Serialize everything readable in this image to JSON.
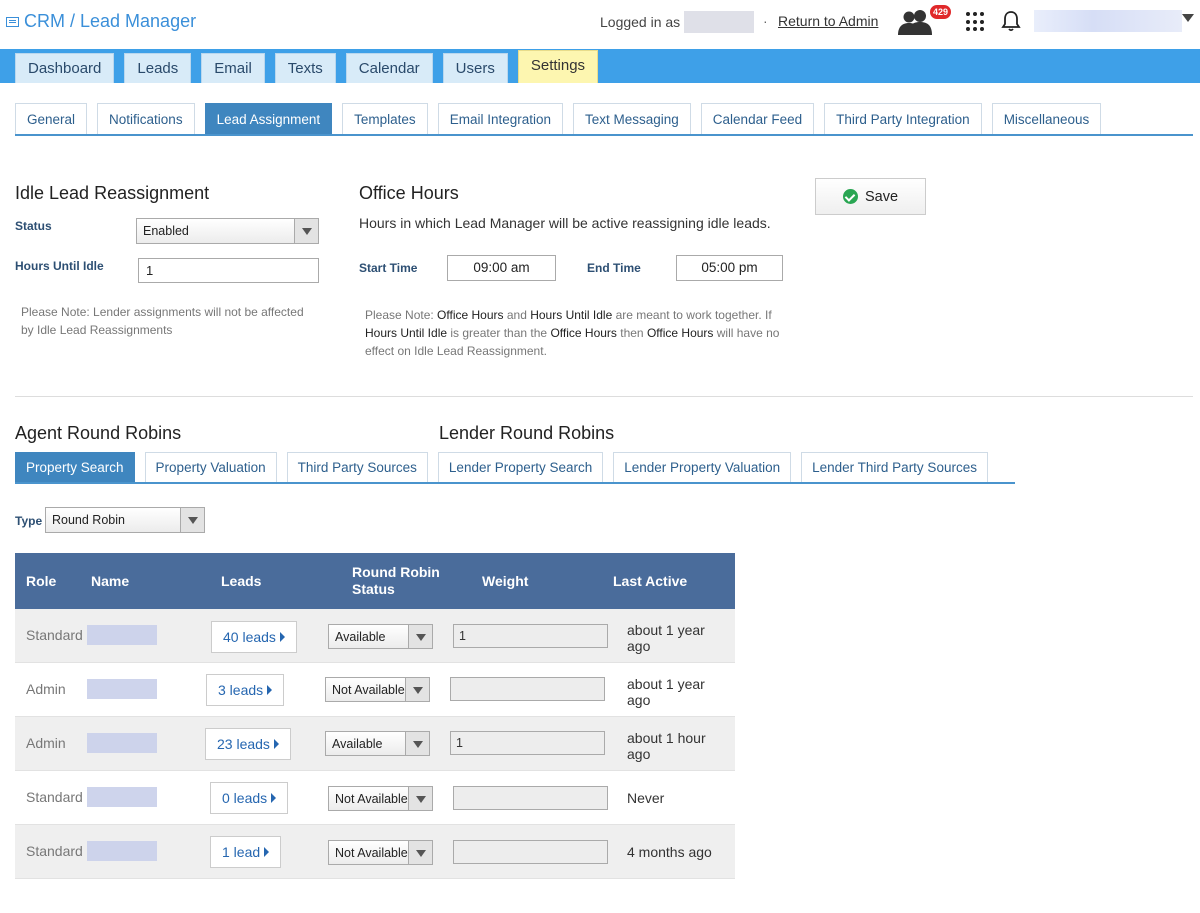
{
  "app": {
    "title": "CRM / Lead Manager"
  },
  "header": {
    "logged_in_label": "Logged in as",
    "separator": "·",
    "return_link": "Return to Admin",
    "notification_count": "429"
  },
  "main_nav": {
    "tabs": [
      {
        "label": "Dashboard"
      },
      {
        "label": "Leads"
      },
      {
        "label": "Email"
      },
      {
        "label": "Texts"
      },
      {
        "label": "Calendar"
      },
      {
        "label": "Users"
      },
      {
        "label": "Settings"
      }
    ],
    "active": "Settings"
  },
  "sub_nav": {
    "tabs": [
      {
        "label": "General"
      },
      {
        "label": "Notifications"
      },
      {
        "label": "Lead Assignment"
      },
      {
        "label": "Templates"
      },
      {
        "label": "Email Integration"
      },
      {
        "label": "Text Messaging"
      },
      {
        "label": "Calendar Feed"
      },
      {
        "label": "Third Party Integration"
      },
      {
        "label": "Miscellaneous"
      }
    ],
    "active": "Lead Assignment"
  },
  "idle": {
    "title": "Idle Lead Reassignment",
    "status_label": "Status",
    "status_value": "Enabled",
    "hours_label": "Hours Until Idle",
    "hours_value": "1",
    "note_line1": "Please Note: Lender assignments will not be affected",
    "note_line2": "by Idle Lead Reassignments"
  },
  "office": {
    "title": "Office Hours",
    "description": "Hours in which Lead Manager will be active reassigning idle leads.",
    "start_label": "Start Time",
    "start_value": "09:00 am",
    "end_label": "End Time",
    "end_value": "05:00 pm",
    "note": {
      "p1": "Please Note: ",
      "b1": "Office Hours",
      "p2": " and ",
      "b2": "Hours Until Idle",
      "p3": " are meant to work together. If",
      "b3": "Hours Until Idle",
      "p4": " is greater than the ",
      "b4": "Office Hours",
      "p5": " then ",
      "b5": "Office Hours",
      "p6": " will have no",
      "p7": "effect on Idle Lead Reassignment."
    }
  },
  "save_button": {
    "label": "Save"
  },
  "round_robins": {
    "agent_title": "Agent Round Robins",
    "lender_title": "Lender Round Robins",
    "tabs": [
      {
        "label": "Property Search"
      },
      {
        "label": "Property Valuation"
      },
      {
        "label": "Third Party Sources"
      },
      {
        "label": "Lender Property Search"
      },
      {
        "label": "Lender Property Valuation"
      },
      {
        "label": "Lender Third Party Sources"
      }
    ],
    "active": "Property Search",
    "type_label": "Type",
    "type_value": "Round Robin"
  },
  "table": {
    "headers": {
      "role": "Role",
      "name": "Name",
      "leads": "Leads",
      "rr_status_1": "Round Robin",
      "rr_status_2": "Status",
      "weight": "Weight",
      "last_active": "Last Active"
    },
    "rows": [
      {
        "role": "Standard",
        "leads": "40 leads",
        "status": "Available",
        "weight": "1",
        "last1": "about 1 year",
        "last2": "ago"
      },
      {
        "role": "Admin",
        "leads": "3 leads",
        "status": "Not Available",
        "weight": "",
        "last1": "about 1 year",
        "last2": "ago"
      },
      {
        "role": "Admin",
        "leads": "23 leads",
        "status": "Available",
        "weight": "1",
        "last1": "about 1 hour",
        "last2": "ago"
      },
      {
        "role": "Standard",
        "leads": "0 leads",
        "status": "Not Available",
        "weight": "",
        "last1": "Never",
        "last2": ""
      },
      {
        "role": "Standard",
        "leads": "1 lead",
        "status": "Not Available",
        "weight": "",
        "last1": "4 months ago",
        "last2": ""
      }
    ]
  },
  "colors": {
    "primary": "#3ea0e8",
    "active_tab": "#3f86bf",
    "table_header": "#4a6c9b",
    "settings_tab": "#fdf6b0"
  }
}
